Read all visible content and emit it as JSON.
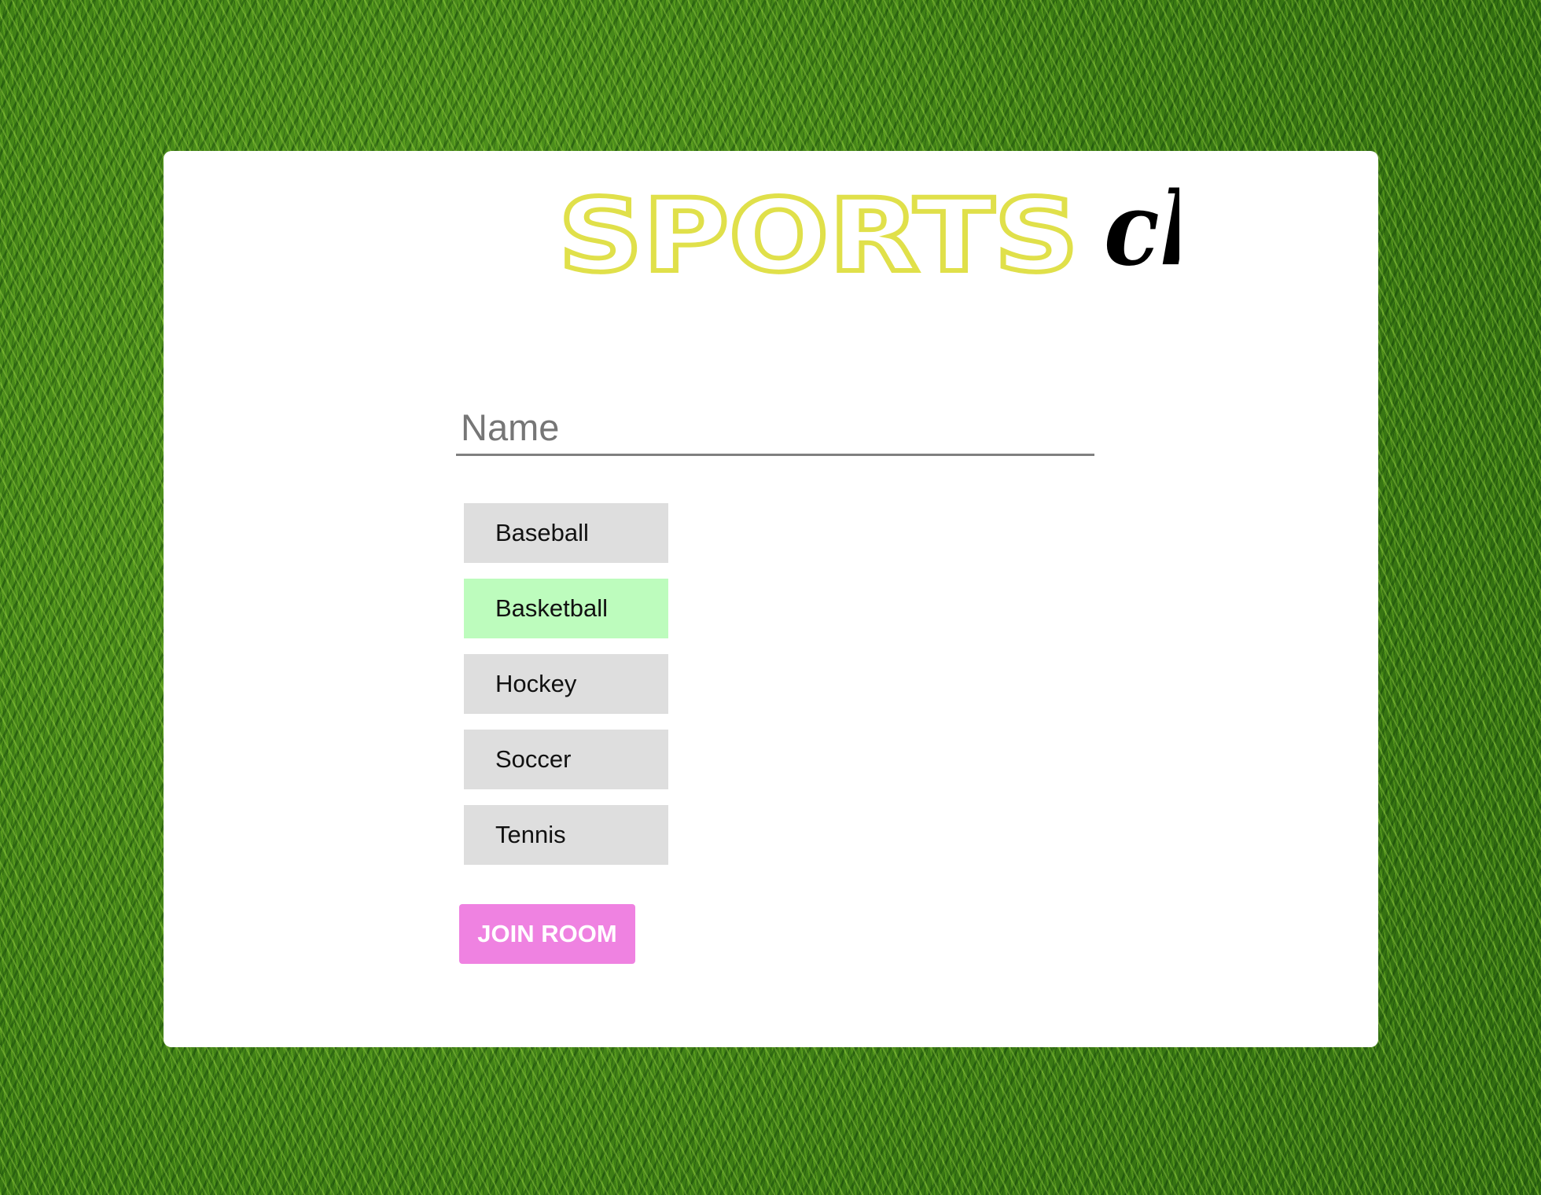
{
  "logo": {
    "part1": "SPORTS",
    "part2": "chat",
    "part1_color": "#e0e04a",
    "part2_color": "#000000"
  },
  "form": {
    "name_placeholder": "Name",
    "name_value": ""
  },
  "sports": {
    "items": [
      {
        "label": "Baseball",
        "selected": false
      },
      {
        "label": "Basketball",
        "selected": true
      },
      {
        "label": "Hockey",
        "selected": false
      },
      {
        "label": "Soccer",
        "selected": false
      },
      {
        "label": "Tennis",
        "selected": false
      }
    ],
    "default_color": "#dedede",
    "selected_color": "#bdfcbd"
  },
  "actions": {
    "join_label": "JOIN ROOM",
    "join_color": "#ef82e1"
  }
}
